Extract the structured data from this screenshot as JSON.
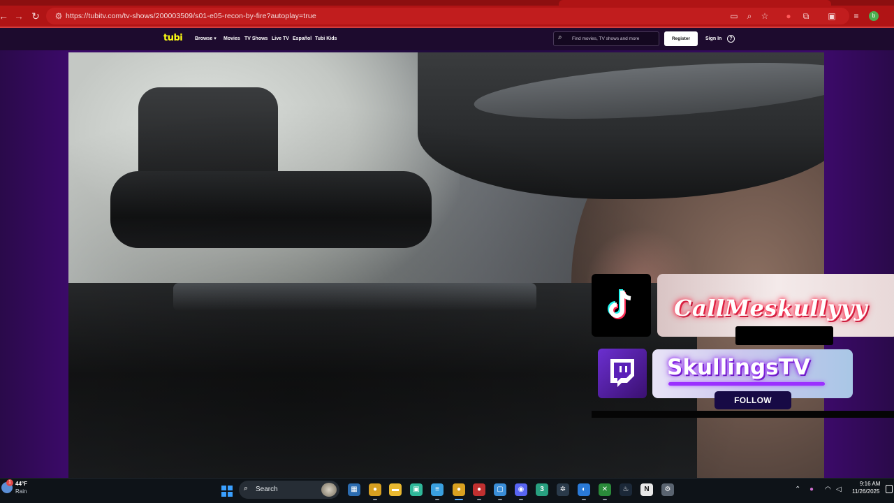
{
  "browser": {
    "url": "https://tubitv.com/tv-shows/200003509/s01-e05-recon-by-fire?autoplay=true",
    "nav_buttons": [
      "back-icon",
      "forward-icon",
      "reload-icon"
    ],
    "omnibox_icons": [
      "site-info-icon",
      "cast-icon",
      "zoom-icon",
      "bookmark-star-icon"
    ],
    "extension_icons": [
      "extension-red-icon",
      "extensions-puzzle-icon",
      "side-panel-icon",
      "media-queue-icon"
    ],
    "profile_initial": "b",
    "theme_color": "#b01415"
  },
  "tubi": {
    "logo": "tubi",
    "nav": {
      "browse": "Browse ▾",
      "movies": "Movies",
      "tv_shows": "TV Shows",
      "live_tv": "Live TV",
      "espanol": "Español",
      "kids": "Tubi Kids"
    },
    "search_placeholder": "Find movies, TV shows and more",
    "register": "Register",
    "sign_in": "Sign In",
    "help": "?"
  },
  "overlay": {
    "tiktok_name": "CallMeskullyyy",
    "twitch_name": "SkullingsTV",
    "follow_label": "FOLLOW"
  },
  "taskbar": {
    "weather_temp": "44°F",
    "weather_cond": "Rain",
    "weather_badge": "1",
    "search_label": "Search",
    "time": "9:16 AM",
    "date": "11/26/2025",
    "apps": [
      {
        "name": "photos-icon",
        "color": "#2b6cb0",
        "glyph": "▦"
      },
      {
        "name": "chrome-icon",
        "color": "#d8a020",
        "glyph": "●"
      },
      {
        "name": "file-explorer-icon",
        "color": "#e8b830",
        "glyph": "▬"
      },
      {
        "name": "android-app-icon",
        "color": "#2fb89a",
        "glyph": "▣"
      },
      {
        "name": "notepad-icon",
        "color": "#3aa0e0",
        "glyph": "≡"
      },
      {
        "name": "chrome-active-icon",
        "color": "#d8a020",
        "glyph": "●"
      },
      {
        "name": "chrome-profile-icon",
        "color": "#c03030",
        "glyph": "●"
      },
      {
        "name": "snipping-icon",
        "color": "#3a8ed8",
        "glyph": "▢"
      },
      {
        "name": "discord-icon",
        "color": "#5865f2",
        "glyph": "◉"
      },
      {
        "name": "three-app-icon",
        "color": "#28a080",
        "glyph": "3"
      },
      {
        "name": "react-icon",
        "color": "#2a3a4a",
        "glyph": "✲"
      },
      {
        "name": "edge-icon",
        "color": "#2a7ad8",
        "glyph": "◐"
      },
      {
        "name": "xbox-icon",
        "color": "#2a8a3a",
        "glyph": "✕"
      },
      {
        "name": "steam-icon",
        "color": "#1b2838",
        "glyph": "♨"
      },
      {
        "name": "notion-icon",
        "color": "#e8e8e8",
        "glyph": "N"
      },
      {
        "name": "settings-icon",
        "color": "#5a6470",
        "glyph": "⚙"
      }
    ],
    "tray_icons": [
      "chevron-up-icon",
      "microphone-icon",
      "wifi-icon",
      "volume-icon"
    ]
  }
}
